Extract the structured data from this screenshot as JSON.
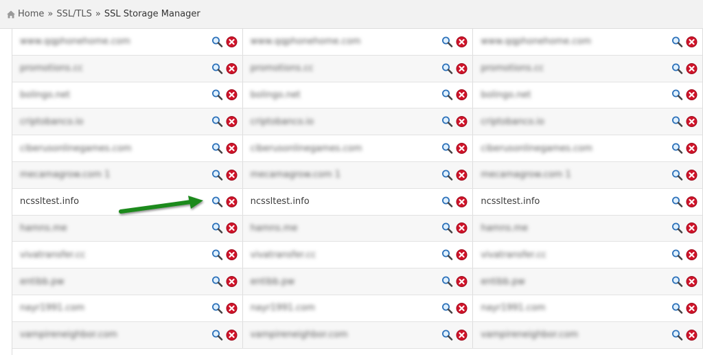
{
  "breadcrumb": {
    "home": "Home",
    "sep1": "»",
    "section": "SSL/TLS",
    "sep2": "»",
    "current": "SSL Storage Manager"
  },
  "colors": {
    "search_icon": "#2a6fb8",
    "delete_icon": "#c8102e",
    "arrow": "#1e8a1e"
  },
  "icons": {
    "view": "search-icon",
    "delete": "delete-x-icon",
    "home": "home-icon"
  },
  "rows": [
    {
      "domain": "www.qqphonehome.com",
      "blurred": true
    },
    {
      "domain": "promotions.cc",
      "blurred": true
    },
    {
      "domain": "bolingo.net",
      "blurred": true
    },
    {
      "domain": "criptobanco.io",
      "blurred": true
    },
    {
      "domain": "ciberusonlinegames.com",
      "blurred": true
    },
    {
      "domain": "mecamagrow.com 1",
      "blurred": true
    },
    {
      "domain": "ncssltest.info",
      "blurred": false
    },
    {
      "domain": "hamns.me",
      "blurred": true
    },
    {
      "domain": "vivatransfer.cc",
      "blurred": true
    },
    {
      "domain": "entibb.pw",
      "blurred": true
    },
    {
      "domain": "nayr1991.com",
      "blurred": true
    },
    {
      "domain": "vampireneighbor.com",
      "blurred": true
    }
  ]
}
